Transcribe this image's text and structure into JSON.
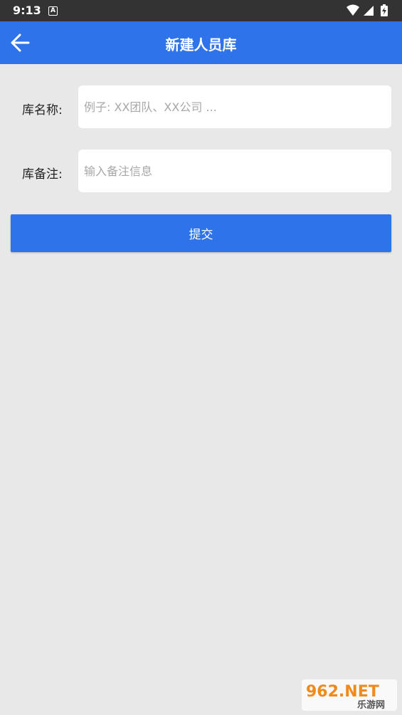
{
  "status_bar": {
    "time": "9:13",
    "notification_icon_letter": "A",
    "icons": [
      "wifi-icon",
      "signal-icon",
      "battery-charging-icon"
    ]
  },
  "app_bar": {
    "title": "新建人员库",
    "back_icon": "arrow-left-icon",
    "color": "#2f73ea"
  },
  "form": {
    "name": {
      "label": "库名称:",
      "placeholder": "例子: XX团队、XX公司 ...",
      "value": ""
    },
    "note": {
      "label": "库备注:",
      "placeholder": "输入备注信息",
      "value": ""
    },
    "submit_label": "提交"
  },
  "watermark": {
    "text_top": "962.NET",
    "text_bottom": "乐游网"
  },
  "colors": {
    "accent": "#2f73ea",
    "background": "#e8e8e8",
    "status_bar": "#333333"
  }
}
